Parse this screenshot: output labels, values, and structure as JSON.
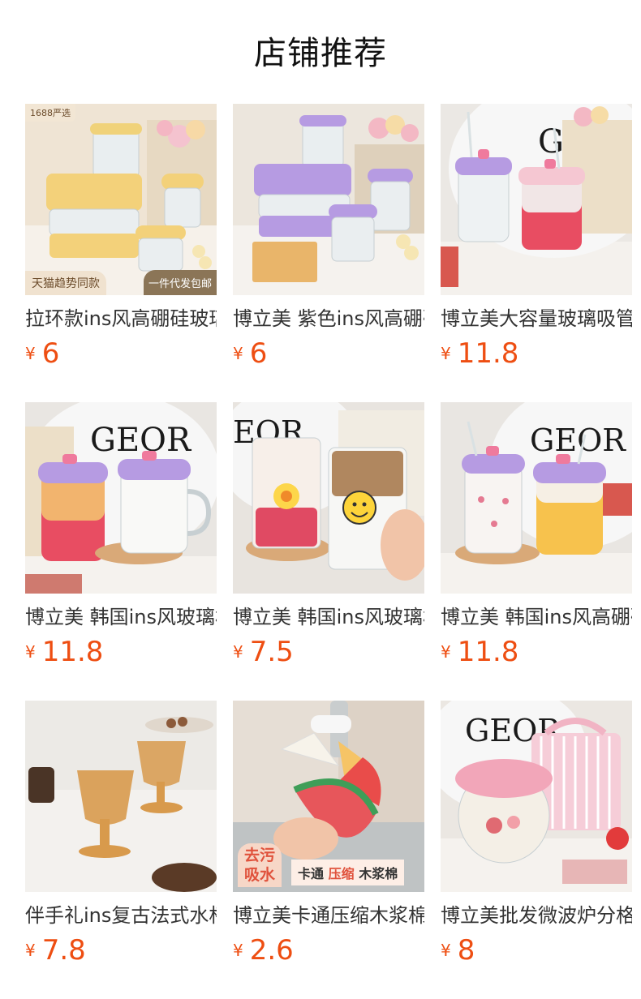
{
  "header": {
    "title": "店铺推荐"
  },
  "currency": "¥",
  "products": [
    {
      "title": "拉环款ins风高硼硅玻璃饭盒",
      "price": "6",
      "image_icon": "glass-food-container-yellow-icon",
      "badges": {
        "top": "1688严选",
        "bottom_left": "天猫趋势同款",
        "bottom_right": "一件代发包邮"
      }
    },
    {
      "title": "博立美 紫色ins风高硼硅玻璃饭盒",
      "price": "6",
      "image_icon": "glass-food-container-purple-icon"
    },
    {
      "title": "博立美大容量玻璃吸管杯",
      "price": "11.8",
      "image_icon": "glass-straw-mug-icon"
    },
    {
      "title": "博立美 韩国ins风玻璃杯",
      "price": "11.8",
      "image_icon": "glass-mug-pair-icon"
    },
    {
      "title": "博立美 韩国ins风玻璃杯",
      "price": "7.5",
      "image_icon": "smiley-glass-cup-icon"
    },
    {
      "title": "博立美 韩国ins风高硼硅玻璃杯",
      "price": "11.8",
      "image_icon": "glass-mug-bow-icon"
    },
    {
      "title": "伴手礼ins复古法式水杯",
      "price": "7.8",
      "image_icon": "vintage-amber-goblet-icon"
    },
    {
      "title": "博立美卡通压缩木浆棉",
      "price": "2.6",
      "image_icon": "watermelon-sponge-icon",
      "tag": {
        "big": "去污\n吸水",
        "part1": "卡通",
        "part2": "压缩",
        "part3": "木浆棉"
      }
    },
    {
      "title": "博立美批发微波炉分格饭盒",
      "price": "8",
      "image_icon": "pink-lunch-box-bag-icon"
    }
  ],
  "colors": {
    "price": "#ee4e12",
    "title": "#333333"
  }
}
